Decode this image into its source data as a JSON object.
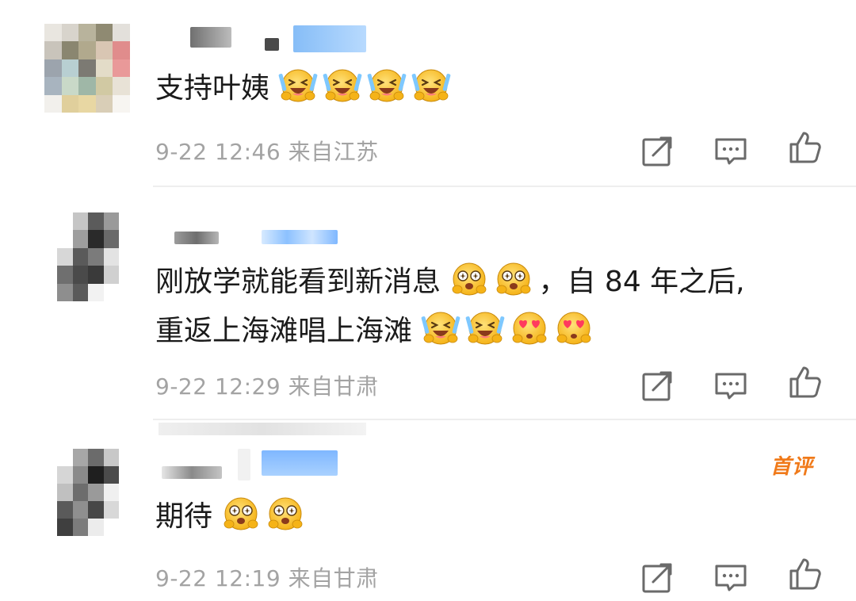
{
  "comments": [
    {
      "text": "支持叶姨",
      "emojis": [
        "grinning-tears-emoji",
        "grinning-tears-emoji",
        "grinning-tears-emoji",
        "grinning-tears-emoji"
      ],
      "date": "9-22",
      "time": "12:46",
      "location": "来自江苏"
    },
    {
      "line1": "刚放学就能看到新消息",
      "line1_emojis": [
        "sparkle-eyes-emoji",
        "sparkle-eyes-emoji"
      ],
      "line1_tail": "，自 84 年之后,",
      "line2": "重返上海滩唱上海滩",
      "line2_emojis": [
        "grinning-tears-emoji",
        "grinning-tears-emoji",
        "heart-eyes-emoji",
        "heart-eyes-emoji"
      ],
      "date": "9-22",
      "time": "12:29",
      "location": "来自甘肃"
    },
    {
      "text": "期待",
      "emojis": [
        "sparkle-eyes-emoji",
        "sparkle-eyes-emoji"
      ],
      "badge": "首评",
      "date": "9-22",
      "time": "12:19",
      "location": "来自甘肃"
    }
  ],
  "colors": {
    "text": "#1b1b1b",
    "meta": "#a3a3a3",
    "icon": "#6a6a6a",
    "badge": "#f07a1a",
    "name_blur": "#8fc3ff"
  },
  "icons": [
    "share-icon",
    "comment-icon",
    "like-icon"
  ]
}
